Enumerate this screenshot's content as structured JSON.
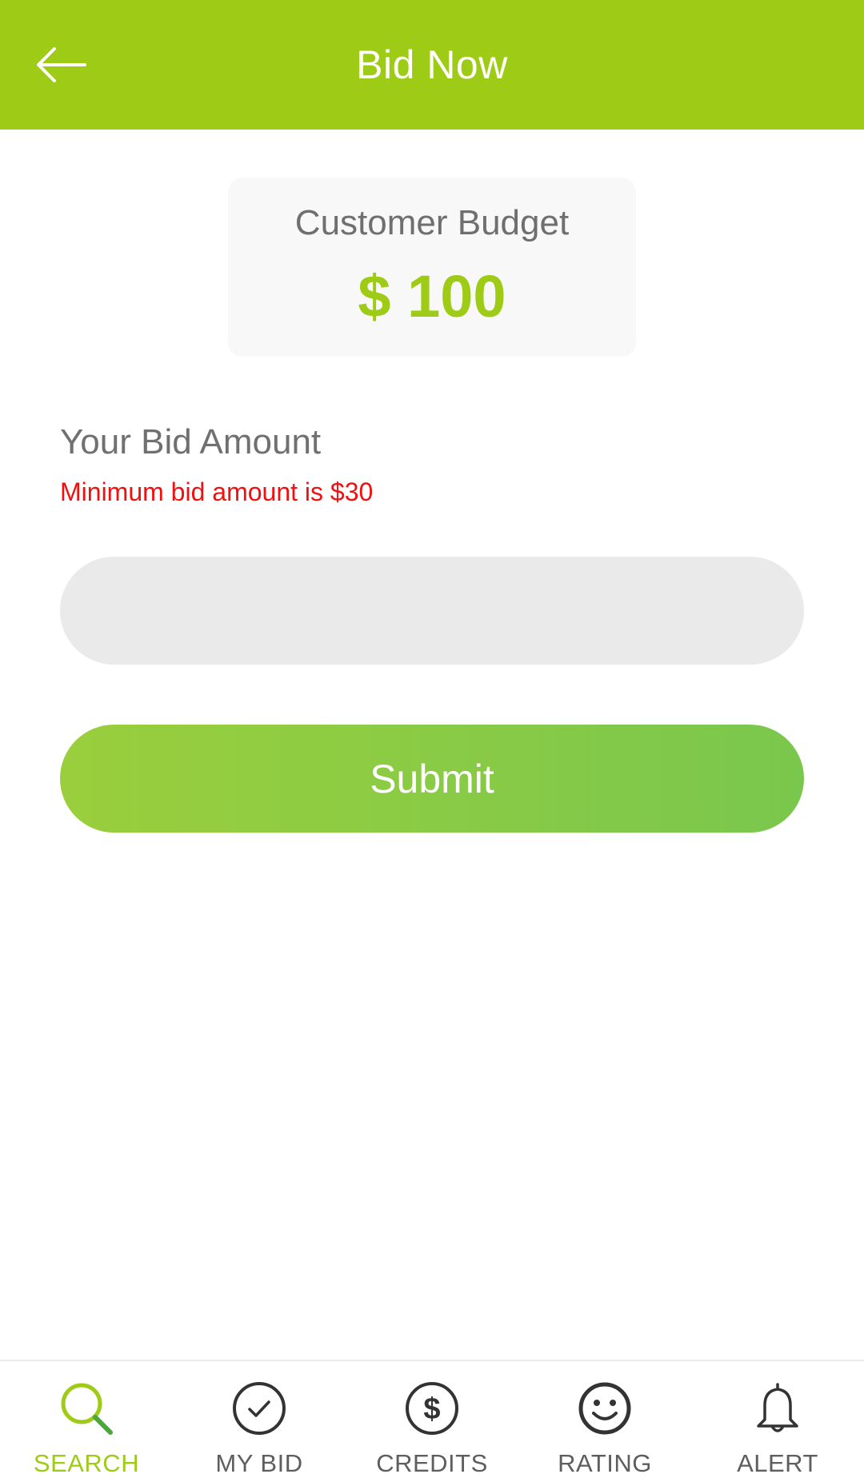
{
  "header": {
    "title": "Bid Now",
    "back_icon": "arrow-left-icon"
  },
  "budget": {
    "label": "Customer Budget",
    "value": "$ 100"
  },
  "bid": {
    "label": "Your Bid Amount",
    "hint": "Minimum bid amount is $30",
    "input_value": "",
    "input_placeholder": "",
    "submit_label": "Submit"
  },
  "nav": {
    "items": [
      {
        "label": "SEARCH",
        "icon": "search-icon",
        "active": true
      },
      {
        "label": "MY BID",
        "icon": "check-circle-icon",
        "active": false
      },
      {
        "label": "CREDITS",
        "icon": "dollar-circle-icon",
        "active": false
      },
      {
        "label": "RATING",
        "icon": "smiley-icon",
        "active": false
      },
      {
        "label": "ALERT",
        "icon": "bell-icon",
        "active": false
      }
    ]
  },
  "colors": {
    "brand_green": "#9ecb16",
    "error_red": "#f01010",
    "input_bg": "#eaeaea",
    "inactive_gray": "#5e5e5e"
  }
}
